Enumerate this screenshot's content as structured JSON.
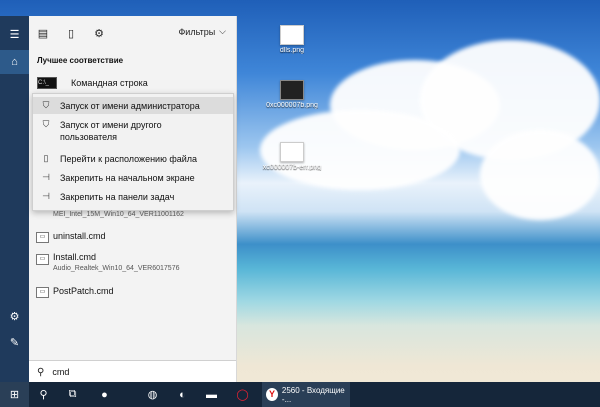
{
  "filters_label": "Фильтры",
  "best_match_heading": "Лучшее соответствие",
  "best_match_item": "Командная строка",
  "context_menu": [
    {
      "icon": "shield-run-icon",
      "glyph": "⛉",
      "label": "Запуск от имени администратора"
    },
    {
      "icon": "run-as-user-icon",
      "glyph": "⛉",
      "label": "Запуск от имени другого пользователя"
    },
    {
      "icon": "open-file-location-icon",
      "glyph": "▯",
      "label": "Перейти к расположению файла"
    },
    {
      "icon": "pin-start-icon",
      "glyph": "⊣",
      "label": "Закрепить на начальном экране"
    },
    {
      "icon": "pin-taskbar-icon",
      "glyph": "⊣",
      "label": "Закрепить на панели задач"
    }
  ],
  "results": [
    {
      "title": "",
      "subtitle": "MEI_Intel_15M_Win10_64_VER11001162"
    },
    {
      "title": "uninstall.cmd",
      "subtitle": ""
    },
    {
      "title": "Install.cmd",
      "subtitle": "Audio_Realtek_Win10_64_VER6017576"
    },
    {
      "title": "PostPatch.cmd",
      "subtitle": ""
    }
  ],
  "search_value": "cmd",
  "desktop_icons": [
    {
      "label": "dlls.png"
    },
    {
      "label": "0xc000007b.png"
    },
    {
      "label": "xc000007b-err.png"
    }
  ],
  "taskbar_window": "2560 - Входящие -...",
  "colors": {
    "accent": "#1f3a5c",
    "taskbar": "#15263a",
    "menu_highlight": "#dcdcdc"
  }
}
